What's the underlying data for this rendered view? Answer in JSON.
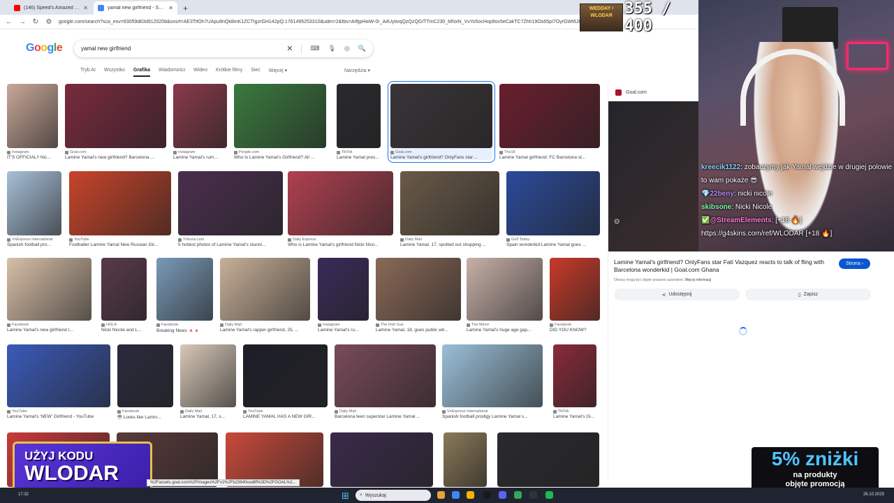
{
  "browser": {
    "tabs": [
      {
        "title": "(146) Speed's Amazed With Th",
        "active": false,
        "favicon_color": "#ff0000"
      },
      {
        "title": "yamal new girlfriend - Szukaj w",
        "active": true,
        "favicon_color": "#4285f4"
      }
    ],
    "new_tab": "+",
    "url": "google.com/search?sca_esv=93059d63d912020b&sxsrf=AE3TifOh7UApu9nQk8mK1ZCTIgzrGH142pQ:1761495253310&udm=2&fbs=AIlfjpHwW-0r_A4UytivqQzQzQGITTmC230_MNxN_VvYo5ocHop9ov5eCakTC7Zhh19Os65pI7OyrGWt6JCO5AH8j"
  },
  "google": {
    "logo_letters": [
      "G",
      "o",
      "o",
      "g",
      "l",
      "e"
    ],
    "search_value": "yamal new girlfriend",
    "filters": [
      "Tryb AI",
      "Wszystko",
      "Grafika",
      "Wiadomości",
      "Wideo",
      "Krótkie filmy",
      "Sieć",
      "Więcej ▾"
    ],
    "active_filter": "Grafika",
    "tools_label": "Narzędzia ▾"
  },
  "results": [
    {
      "src": "Instagram",
      "cap": "IT'S OFFICIAL!! Nic...",
      "color": "#c9a89a"
    },
    {
      "src": "Goal.com",
      "cap": "Lamine Yamal's new girlfriend? Barcelona ...",
      "color": "#7a2a3e"
    },
    {
      "src": "Instagram",
      "cap": "Lamine Yamal's rum...",
      "color": "#8a3a4a"
    },
    {
      "src": "People.com",
      "cap": "Who Is Lamine Yamal's Girlfriend? All ...",
      "color": "#3a7a3e"
    },
    {
      "src": "TikTok",
      "cap": "Lamine Yamal pres...",
      "color": "#2a2a2e"
    },
    {
      "src": "Goal.com",
      "cap": "Lamine Yamal's girlfriend? OnlyFans star ...",
      "color": "#3a3438"
    },
    {
      "src": "The18",
      "cap": "Lamine Yamal girlfriend: FC Barcelona st...",
      "color": "#6a1e2e"
    },
    {
      "src": "VnExpress International",
      "cap": "Spanish football pro...",
      "color": "#a8c0d8"
    },
    {
      "src": "YouTube",
      "cap": "Footballer Lamine Yamal New Russian Gir...",
      "color": "#c8442a"
    },
    {
      "src": "Tribuna.com",
      "cap": "5 hottest photos of Lamine Yamal's stunni...",
      "color": "#4a2e4e"
    },
    {
      "src": "Daily Express",
      "cap": "Who is Lamine Yamal's girlfriend Nicki Nico...",
      "color": "#b04050"
    },
    {
      "src": "Daily Mail",
      "cap": "Lamine Yamal, 17, spotted out shopping ...",
      "color": "#6a5a48"
    },
    {
      "src": "Golf Today",
      "cap": "Spain wonderkid Lamine Yamal goes ...",
      "color": "#2a4a9a"
    },
    {
      "src": "Facebook",
      "cap": "Lamine Yamal's new girlfriend I...",
      "color": "#d8c0a8"
    },
    {
      "src": "HOLA",
      "cap": "Nicki Nicole and L...",
      "color": "#5a3a4a"
    },
    {
      "src": "Facebook",
      "cap": "Breaking News 🔺🔺",
      "color": "#7a9ab8"
    },
    {
      "src": "Daily Mail",
      "cap": "Lamine Yamal's rapper girlfriend, 25, ...",
      "color": "#c8b098"
    },
    {
      "src": "Instagram",
      "cap": "Lamine Yamal's ru...",
      "color": "#3a2a5a"
    },
    {
      "src": "The Irish Sun",
      "cap": "Lamine Yamal, 18, goes public wit...",
      "color": "#8a6a58"
    },
    {
      "src": "The Mirror",
      "cap": "Lamine Yamal's huge age gap...",
      "color": "#c8b0a8"
    },
    {
      "src": "Facebook",
      "cap": "DID YOU KNOW?",
      "color": "#c83a2a"
    },
    {
      "src": "YouTube",
      "cap": "Lamine Yamal's 'NEW' Girlfriend - YouTube",
      "color": "#3a5ab8"
    },
    {
      "src": "Facebook",
      "cap": "😳 Looks like Lamin...",
      "color": "#2a2a3e"
    },
    {
      "src": "Daily Mail",
      "cap": "Lamine Yamal, 17, s...",
      "color": "#d8c8b8"
    },
    {
      "src": "YouTube",
      "cap": "LAMINE YAMAL HAS A NEW GIR...",
      "color": "#1e1e2a"
    },
    {
      "src": "Daily Mail",
      "cap": "Barcelona teen superstar Lamine Yamal ...",
      "color": "#7a4a5a"
    },
    {
      "src": "VnExpress International",
      "cap": "Spanish football prodigy Lamine Yamal s...",
      "color": "#9ac0d8"
    },
    {
      "src": "TikTok",
      "cap": "Lamine Yamal's Gi...",
      "color": "#8a2a3a"
    },
    {
      "src": "",
      "cap": "",
      "color": "#c83a3a"
    },
    {
      "src": "",
      "cap": "",
      "color": "#5a3a3a"
    },
    {
      "src": "",
      "cap": "",
      "color": "#c84a3a"
    },
    {
      "src": "",
      "cap": "",
      "color": "#3a2a4a"
    },
    {
      "src": "",
      "cap": "",
      "color": "#8a7a58"
    },
    {
      "src": "",
      "cap": "",
      "color": "#2a2a2e"
    }
  ],
  "panel": {
    "source": "Goal.com",
    "title": "Lamine Yamal's girlfriend? OnlyFans star Fati Vazquez reacts to talk of fling with Barcelona wonderkid | Goal.com Ghana",
    "visit_label": "Strona ›",
    "note": "Obrazy mogą być objęte prawami autorskimi.",
    "note_link": "Więcej informacji",
    "share_label": "Udostępnij",
    "save_label": "Zapisz"
  },
  "stream": {
    "counter_badge": "WEDDAY • WLODAR",
    "counter": "355 / 400",
    "chat": [
      {
        "user": "kreecik1122",
        "text": ": zobaczymy jak Yamal wejdzie w drugiej polowie to wam pokaże 😎",
        "color": "#7fd4ff"
      },
      {
        "user": "22beny",
        "text": ": nicki nicole",
        "color": "#b48cff",
        "prefix": "💎"
      },
      {
        "user": "skibsone",
        "text": ": Nicki Nicole",
        "color": "#7fffa8"
      },
      {
        "user": "@StreamElements",
        "text": ": [+18 🔥]",
        "color": "#ff7ad9",
        "prefix": "✅"
      },
      {
        "user": "",
        "text": "https://g4skins.com/ref/WLODAR [+18 🔥]",
        "color": "#ffffff"
      }
    ],
    "promo_line1": "UŻYJ KODU",
    "promo_line2": "WLODAR",
    "promo2_line1": "5% zniżki",
    "promo2_line2": "na produkty",
    "promo2_line3": "objęte promocją",
    "status_url": "%2Fassets.goal.com%2Fimages%2Fv1%2Fb23840ced8f%3D%2FGOAL%2..."
  },
  "taskbar": {
    "time": "17:32",
    "search_placeholder": "Wyszukaj",
    "date": "26.10.2025",
    "icon_colors": [
      "#e8a33a",
      "#4285f4",
      "#f4b400",
      "#1a1a1a",
      "#5865f2",
      "#34a853",
      "#333333",
      "#1db954"
    ]
  }
}
